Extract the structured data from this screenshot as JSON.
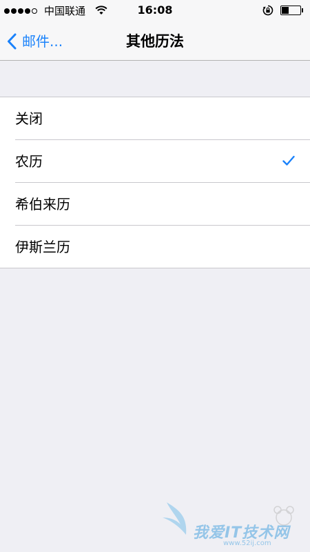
{
  "status_bar": {
    "carrier": "中国联通",
    "time": "16:08",
    "battery_level": 0.4
  },
  "nav": {
    "back_label": "邮件...",
    "title": "其他历法"
  },
  "calendar_options": [
    {
      "label": "关闭",
      "selected": false
    },
    {
      "label": "农历",
      "selected": true
    },
    {
      "label": "希伯来历",
      "selected": false
    },
    {
      "label": "伊斯兰历",
      "selected": false
    }
  ],
  "watermark": {
    "text": "我爱IT技术网",
    "url": "www.52ij.com"
  },
  "colors": {
    "accent": "#1a82fb",
    "background": "#efeff4"
  }
}
